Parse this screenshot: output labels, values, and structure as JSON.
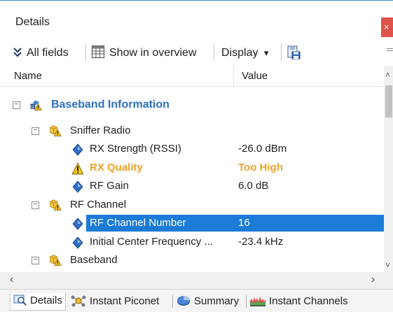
{
  "window": {
    "title": "Details",
    "close_glyph": "×"
  },
  "toolbar": {
    "all_fields": "All fields",
    "show_overview": "Show in overview",
    "display": "Display",
    "display_caret": "▾"
  },
  "columns": {
    "name": "Name",
    "value": "Value"
  },
  "tree": {
    "baseband_info": {
      "label": "Baseband Information"
    },
    "sniffer_radio": {
      "label": "Sniffer Radio"
    },
    "rx_strength": {
      "label": "RX Strength (RSSI)",
      "value": "-26.0 dBm"
    },
    "rx_quality": {
      "label": "RX Quality",
      "value": "Too High"
    },
    "rf_gain": {
      "label": "RF Gain",
      "value": "6.0 dB"
    },
    "rf_channel": {
      "label": "RF Channel"
    },
    "rf_channel_number": {
      "label": "RF Channel Number",
      "value": "16"
    },
    "initial_center_freq": {
      "label": "Initial Center Frequency ...",
      "value": "-23.4 kHz"
    },
    "baseband": {
      "label": "Baseband"
    }
  },
  "tabs": {
    "details": "Details",
    "instant_piconet": "Instant Piconet",
    "summary": "Summary",
    "instant_channels": "Instant Channels"
  },
  "colors": {
    "accent": "#2e6fbe",
    "selection": "#1c7bd6",
    "warning": "#f0a22a",
    "close": "#e0524c"
  },
  "icons": {
    "expand_all": "double-chevron-down-icon",
    "overview": "table-icon",
    "export": "save-export-icon",
    "baseband_info": "baseband-warning-icon",
    "field": "blue-diamond-icon",
    "warning": "warning-triangle-icon",
    "folder_warning": "folder-warning-icon"
  }
}
